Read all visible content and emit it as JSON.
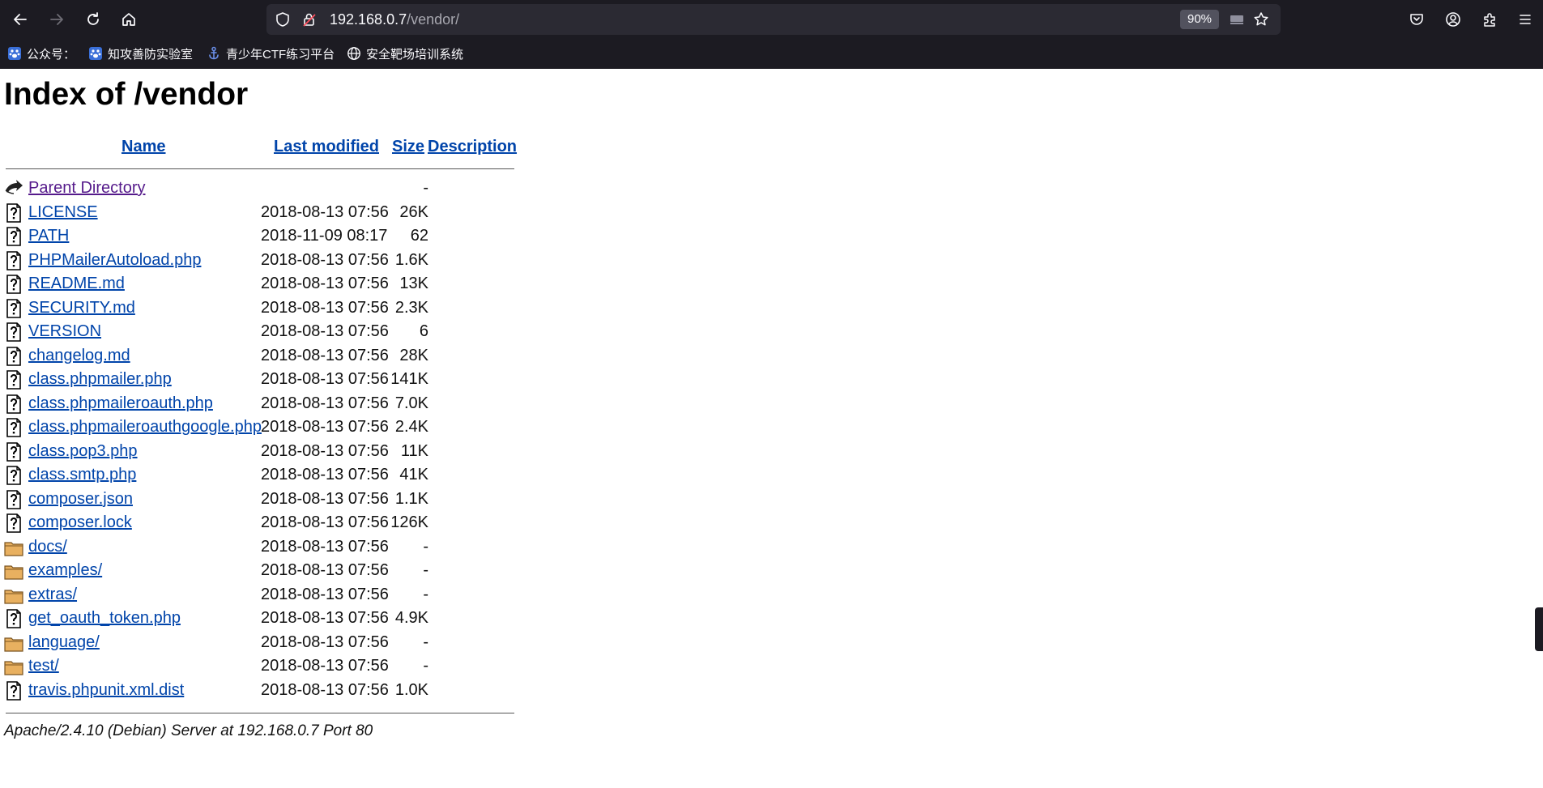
{
  "browser": {
    "url_host": "192.168.0.7",
    "url_path": "/vendor/",
    "zoom": "90%",
    "bookmarks": [
      {
        "label": "公众号：",
        "icon": "paw-icon"
      },
      {
        "label": "知攻善防实验室",
        "icon": "paw-icon"
      },
      {
        "label": "青少年CTF练习平台",
        "icon": "anchor-icon"
      },
      {
        "label": "安全靶场培训系统",
        "icon": "globe-icon"
      }
    ]
  },
  "page": {
    "title": "Index of /vendor",
    "columns": {
      "name": "Name",
      "last_modified": "Last modified",
      "size": "Size",
      "description": "Description"
    },
    "entries": [
      {
        "name": "Parent Directory",
        "date": "",
        "size": "-",
        "type": "back"
      },
      {
        "name": "LICENSE",
        "date": "2018-08-13 07:56",
        "size": "26K",
        "type": "file"
      },
      {
        "name": "PATH",
        "date": "2018-11-09 08:17",
        "size": "62",
        "type": "file"
      },
      {
        "name": "PHPMailerAutoload.php",
        "date": "2018-08-13 07:56",
        "size": "1.6K",
        "type": "file"
      },
      {
        "name": "README.md",
        "date": "2018-08-13 07:56",
        "size": "13K",
        "type": "file"
      },
      {
        "name": "SECURITY.md",
        "date": "2018-08-13 07:56",
        "size": "2.3K",
        "type": "file"
      },
      {
        "name": "VERSION",
        "date": "2018-08-13 07:56",
        "size": "6",
        "type": "file"
      },
      {
        "name": "changelog.md",
        "date": "2018-08-13 07:56",
        "size": "28K",
        "type": "file"
      },
      {
        "name": "class.phpmailer.php",
        "date": "2018-08-13 07:56",
        "size": "141K",
        "type": "file"
      },
      {
        "name": "class.phpmaileroauth.php",
        "date": "2018-08-13 07:56",
        "size": "7.0K",
        "type": "file"
      },
      {
        "name": "class.phpmaileroauthgoogle.php",
        "date": "2018-08-13 07:56",
        "size": "2.4K",
        "type": "file"
      },
      {
        "name": "class.pop3.php",
        "date": "2018-08-13 07:56",
        "size": "11K",
        "type": "file"
      },
      {
        "name": "class.smtp.php",
        "date": "2018-08-13 07:56",
        "size": "41K",
        "type": "file"
      },
      {
        "name": "composer.json",
        "date": "2018-08-13 07:56",
        "size": "1.1K",
        "type": "file"
      },
      {
        "name": "composer.lock",
        "date": "2018-08-13 07:56",
        "size": "126K",
        "type": "file"
      },
      {
        "name": "docs/",
        "date": "2018-08-13 07:56",
        "size": "-",
        "type": "folder"
      },
      {
        "name": "examples/",
        "date": "2018-08-13 07:56",
        "size": "-",
        "type": "folder"
      },
      {
        "name": "extras/",
        "date": "2018-08-13 07:56",
        "size": "-",
        "type": "folder"
      },
      {
        "name": "get_oauth_token.php",
        "date": "2018-08-13 07:56",
        "size": "4.9K",
        "type": "file"
      },
      {
        "name": "language/",
        "date": "2018-08-13 07:56",
        "size": "-",
        "type": "folder"
      },
      {
        "name": "test/",
        "date": "2018-08-13 07:56",
        "size": "-",
        "type": "folder"
      },
      {
        "name": "travis.phpunit.xml.dist",
        "date": "2018-08-13 07:56",
        "size": "1.0K",
        "type": "file"
      }
    ],
    "footer": "Apache/2.4.10 (Debian) Server at 192.168.0.7 Port 80"
  },
  "colors": {
    "chrome_bg": "#1c1b22",
    "urlbar_bg": "#2b2a33",
    "link": "#0044aa",
    "visited": "#551a8b",
    "folder": "#e8b060"
  }
}
